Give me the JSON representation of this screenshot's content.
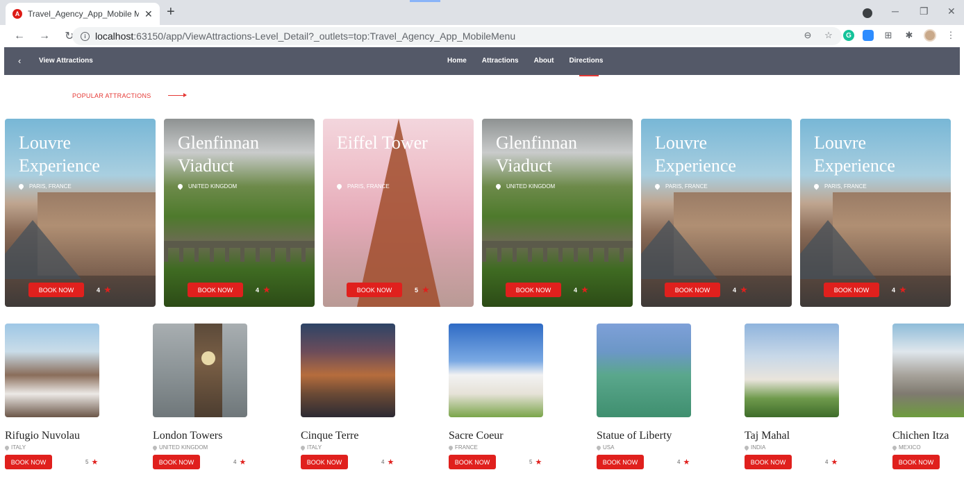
{
  "browser": {
    "tab_title": "Travel_Agency_App_Mobile Menu",
    "favicon_letter": "A",
    "new_tab": "+",
    "url_host": "localhost",
    "url_rest": ":63150/app/ViewAttractions-Level_Detail?_outlets=top:Travel_Agency_App_MobileMenu"
  },
  "header": {
    "title": "View Attractions",
    "nav": [
      "Home",
      "Attractions",
      "About",
      "Directions"
    ],
    "active_nav": "Directions"
  },
  "section": {
    "label": "POPULAR ATTRACTIONS"
  },
  "featured": [
    {
      "title": "Louvre Experience",
      "location": "PARIS, FRANCE",
      "button": "BOOK NOW",
      "rating": "4",
      "theme": "louvre"
    },
    {
      "title": "Glenfinnan Viaduct",
      "location": "UNITED KINGDOM",
      "button": "BOOK NOW",
      "rating": "4",
      "theme": "glen"
    },
    {
      "title": "Eiffel Tower",
      "location": "PARIS, FRANCE",
      "button": "BOOK NOW",
      "rating": "5",
      "theme": "eiffel"
    },
    {
      "title": "Glenfinnan Viaduct",
      "location": "UNITED KINGDOM",
      "button": "BOOK NOW",
      "rating": "4",
      "theme": "glen"
    },
    {
      "title": "Louvre Experience",
      "location": "PARIS, FRANCE",
      "button": "BOOK NOW",
      "rating": "4",
      "theme": "louvre"
    },
    {
      "title": "Louvre Experience",
      "location": "PARIS, FRANCE",
      "button": "BOOK NOW",
      "rating": "4",
      "theme": "louvre"
    }
  ],
  "attractions": [
    {
      "name": "Rifugio Nuvolau",
      "location": "ITALY",
      "button": "BOOK NOW",
      "rating": "5",
      "theme": "rifugio"
    },
    {
      "name": "London Towers",
      "location": "UNITED KINGDOM",
      "button": "BOOK NOW",
      "rating": "4",
      "theme": "london"
    },
    {
      "name": "Cinque Terre",
      "location": "ITALY",
      "button": "BOOK NOW",
      "rating": "4",
      "theme": "cinque"
    },
    {
      "name": "Sacre Coeur",
      "location": "FRANCE",
      "button": "BOOK NOW",
      "rating": "5",
      "theme": "sacre"
    },
    {
      "name": "Statue of Liberty",
      "location": "USA",
      "button": "BOOK NOW",
      "rating": "4",
      "theme": "liberty"
    },
    {
      "name": "Taj Mahal",
      "location": "INDIA",
      "button": "BOOK NOW",
      "rating": "4",
      "theme": "taj"
    },
    {
      "name": "Chichen Itza",
      "location": "MEXICO",
      "button": "BOOK NOW",
      "rating": "",
      "theme": "chichen"
    }
  ],
  "colors": {
    "accent": "#e0201d",
    "header_bg": "#545968"
  }
}
